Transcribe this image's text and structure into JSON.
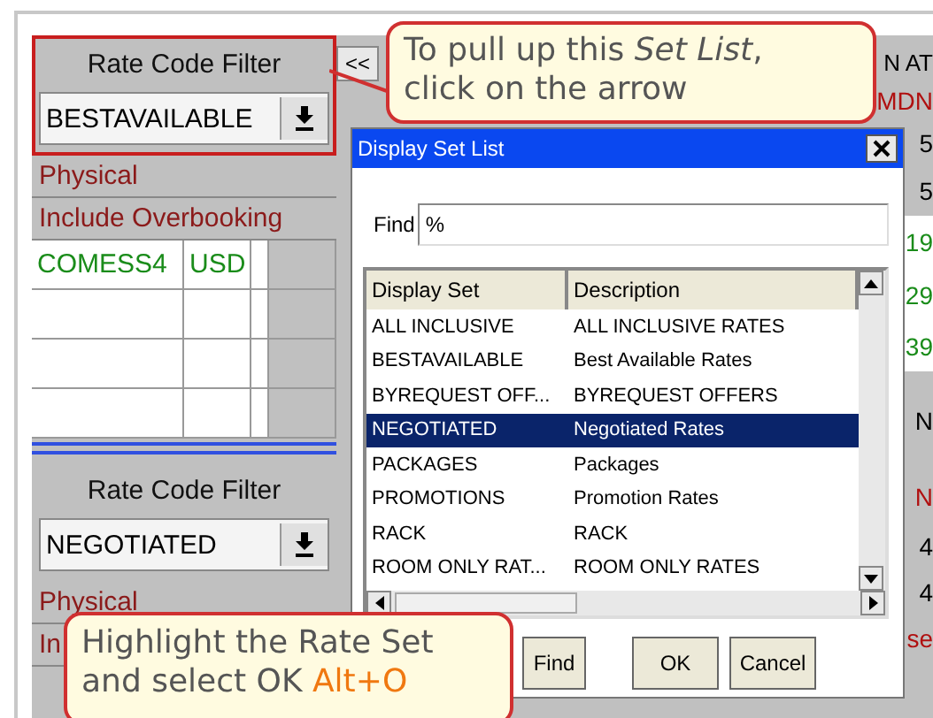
{
  "top_panel": {
    "filter_label": "Rate Code Filter",
    "filter_value": "BESTAVAILABLE",
    "options": [
      "Physical",
      "Include Overbooking"
    ],
    "rows": [
      [
        "COMESS4",
        "USD"
      ],
      [
        "",
        ""
      ],
      [
        "",
        ""
      ],
      [
        "",
        ""
      ]
    ]
  },
  "bottom_panel": {
    "filter_label": "Rate Code Filter",
    "filter_value": "NEGOTIATED",
    "options": [
      "Physical",
      "In"
    ]
  },
  "collapse_button": "<<",
  "right_edge": [
    {
      "text": "N AT",
      "kind": "header"
    },
    {
      "text": "MDN",
      "kind": "red"
    },
    {
      "text": "5",
      "kind": "plain"
    },
    {
      "text": "5",
      "kind": "plain"
    },
    {
      "text": "19",
      "kind": "green"
    },
    {
      "text": "29",
      "kind": "green"
    },
    {
      "text": "39",
      "kind": "green"
    },
    {
      "text": "N",
      "kind": "plain"
    },
    {
      "text": "N",
      "kind": "red"
    },
    {
      "text": "4",
      "kind": "plain"
    },
    {
      "text": "4",
      "kind": "plain"
    },
    {
      "text": "se",
      "kind": "red"
    }
  ],
  "dialog": {
    "title": "Display Set List",
    "find_label": "Find",
    "find_value": "%",
    "columns": [
      "Display Set",
      "Description"
    ],
    "rows": [
      {
        "display_set": "ALL INCLUSIVE",
        "description": "ALL INCLUSIVE RATES",
        "selected": false
      },
      {
        "display_set": "BESTAVAILABLE",
        "description": "Best Available Rates",
        "selected": false
      },
      {
        "display_set": "BYREQUEST OFF...",
        "description": "BYREQUEST OFFERS",
        "selected": false
      },
      {
        "display_set": "NEGOTIATED",
        "description": "Negotiated Rates",
        "selected": true
      },
      {
        "display_set": "PACKAGES",
        "description": "Packages",
        "selected": false
      },
      {
        "display_set": "PROMOTIONS",
        "description": "Promotion Rates",
        "selected": false
      },
      {
        "display_set": "RACK",
        "description": "RACK",
        "selected": false
      },
      {
        "display_set": "ROOM ONLY RAT...",
        "description": "ROOM ONLY RATES",
        "selected": false
      }
    ],
    "buttons": [
      "Find",
      "OK",
      "Cancel"
    ]
  },
  "callouts": [
    {
      "text": "To pull up this *Set List*, click on the arrow"
    },
    {
      "text": "Highlight the Rate Set and select OK **Alt+O**"
    }
  ]
}
